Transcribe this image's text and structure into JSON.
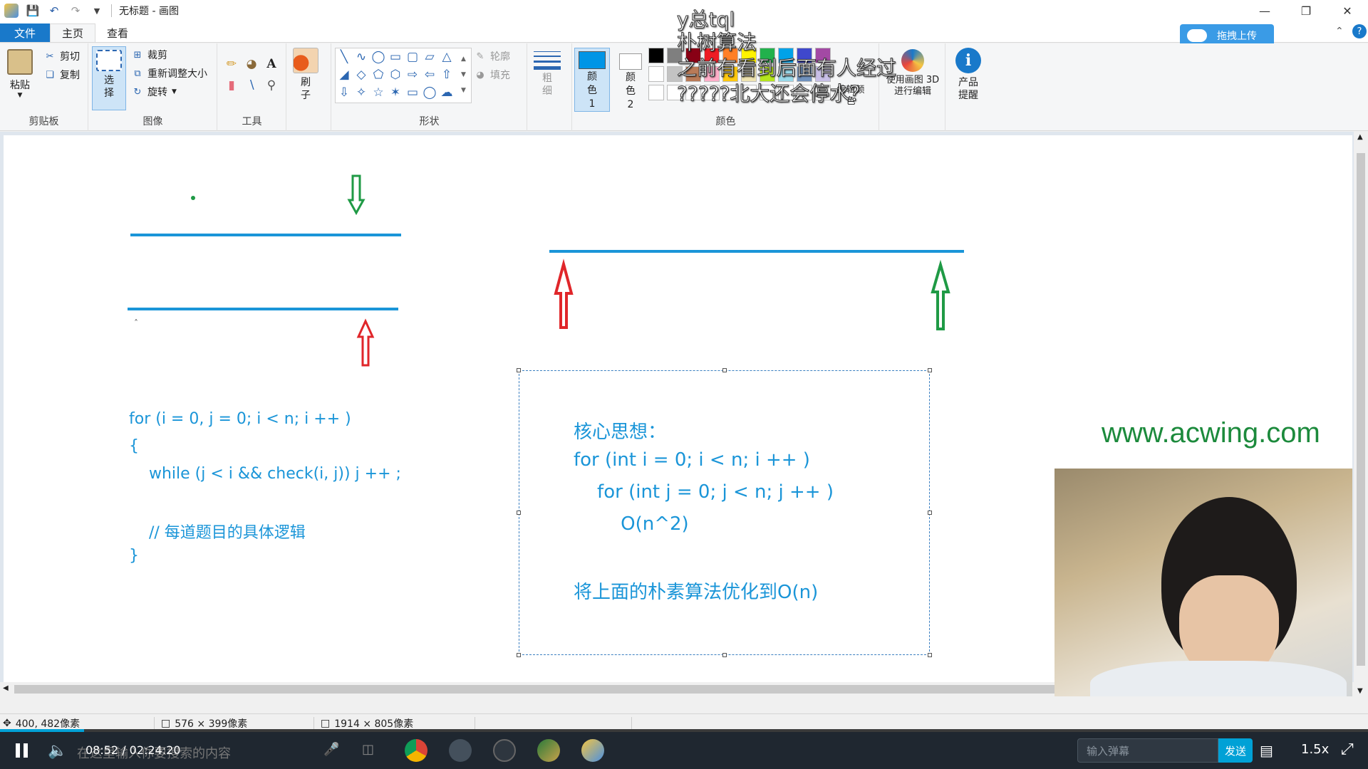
{
  "window": {
    "title": "无标题 - 画图",
    "controls": [
      "minimize-icon",
      "restore-icon",
      "close-icon"
    ]
  },
  "tabs": [
    "文件",
    "主页",
    "查看"
  ],
  "upload_button": "拖拽上传",
  "ribbon": {
    "clipboard": {
      "label": "剪贴板",
      "paste": "粘贴",
      "cut": "剪切",
      "copy": "复制"
    },
    "image": {
      "label": "图像",
      "select": "选择",
      "crop": "裁剪",
      "resize": "重新调整大小",
      "rotate": "旋转"
    },
    "tools": {
      "label": "工具"
    },
    "brushes": {
      "label": "刷子"
    },
    "shapes": {
      "label": "形状",
      "outline": "轮廓",
      "fill": "填充"
    },
    "size": {
      "label": "粗细"
    },
    "colors": {
      "label": "颜色",
      "color1": "颜色 1",
      "color2": "颜色 2",
      "edit_colors": "编辑颜色",
      "edit_3d": "使用画图 3D 进行编辑",
      "product_alert": "产品提醒",
      "palette": [
        "#000000",
        "#7f7f7f",
        "#880015",
        "#ed1c24",
        "#ff7f27",
        "#fff200",
        "#22b14c",
        "#00a2e8",
        "#3f48cc",
        "#a349a4",
        "#ffffff",
        "#c3c3c3",
        "#b97a57",
        "#ffaec9",
        "#ffc90e",
        "#efe4b0",
        "#b5e61d",
        "#99d9ea",
        "#7092be",
        "#c8bfe7"
      ],
      "active_color": "#0095e6"
    }
  },
  "canvas": {
    "code_left": [
      "for (i = 0, j = 0; i < n; i ++ )",
      "{",
      "    while (j < i && check(i, j)) j ++ ;",
      "",
      "    // 每道题目的具体逻辑",
      "}"
    ],
    "code_right": [
      "核心思想：",
      "for (int i = 0; i < n; i ++ )",
      "    for (int j = 0; j < n; j ++ )",
      "        O(n^2)",
      "",
      "将上面的朴素算法优化到O(n)"
    ],
    "accent_blue": "#1a95d8",
    "arrow_red": "#e0262a",
    "arrow_green": "#1f9a45"
  },
  "watermark": "www.acwing.com",
  "danmaku": [
    "y总tql",
    "朴树算法",
    "之前有看到后面有人经过",
    "?????北大还会停水？"
  ],
  "statusbar": {
    "cursor_pos": "400, 482像素",
    "selection_size": "576 × 399像素",
    "image_size": "1914 × 805像素"
  },
  "player": {
    "time": "08:52 / 02:24:20",
    "search_hint": "在这里输入你要搜索的内容",
    "danmaku_placeholder": "输入弹幕",
    "send": "发送",
    "speed": "1.5x",
    "progress": 0.0614
  }
}
